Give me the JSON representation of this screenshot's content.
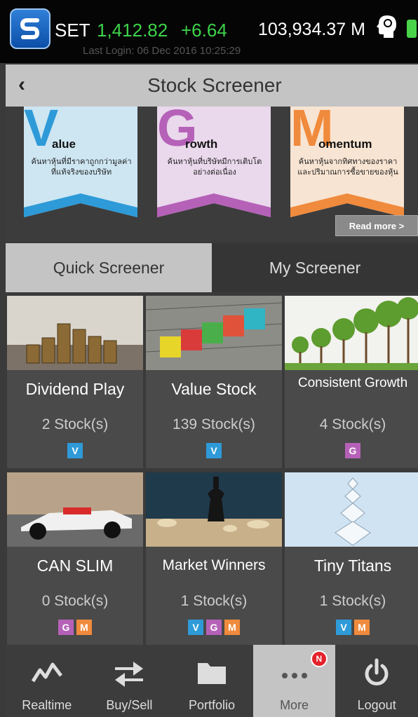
{
  "status": {
    "index_name": "SET",
    "index_value": "1,412.82",
    "index_change": "+6.64",
    "volume": "103,934.37 M",
    "last_login": "Last Login: 06 Dec 2016 10:25:29"
  },
  "header": {
    "title": "Stock Screener"
  },
  "banner": {
    "items": [
      {
        "letter": "V",
        "word": "alue",
        "desc": "ค้นหาหุ้นที่มีราคาถูกกว่ามูลค่าที่แท้จริงของบริษัท",
        "color": "#2e9ad8",
        "bg": "#cde6f2"
      },
      {
        "letter": "G",
        "word": "rowth",
        "desc": "ค้นหาหุ้นที่บริษัทมีการเติบโตอย่างต่อเนื่อง",
        "color": "#b561b8",
        "bg": "#ead8ec"
      },
      {
        "letter": "M",
        "word": "omentum",
        "desc": "ค้นหาหุ้นจากทิศทางของราคาและปริมาณการซื้อขายของหุ้น",
        "color": "#f08a3c",
        "bg": "#f8e4d2"
      }
    ],
    "read_more": "Read more >"
  },
  "tabs": [
    {
      "label": "Quick Screener",
      "active": true
    },
    {
      "label": "My Screener",
      "active": false
    }
  ],
  "screeners": [
    {
      "title": "Dividend Play",
      "count": "2 Stock(s)",
      "badges": [
        "V"
      ]
    },
    {
      "title": "Value Stock",
      "count": "139 Stock(s)",
      "badges": [
        "V"
      ]
    },
    {
      "title": "Consistent Growth",
      "count": "4 Stock(s)",
      "badges": [
        "G"
      ]
    },
    {
      "title": "CAN SLIM",
      "count": "0 Stock(s)",
      "badges": [
        "G",
        "M"
      ]
    },
    {
      "title": "Market Winners",
      "count": "1 Stock(s)",
      "badges": [
        "V",
        "G",
        "M"
      ]
    },
    {
      "title": "Tiny Titans",
      "count": "1 Stock(s)",
      "badges": [
        "V",
        "M"
      ]
    }
  ],
  "nav": [
    {
      "label": "Realtime",
      "icon": "line-chart-icon"
    },
    {
      "label": "Buy/Sell",
      "icon": "transfer-arrows-icon"
    },
    {
      "label": "Portfolio",
      "icon": "folder-icon"
    },
    {
      "label": "More",
      "icon": "more-dots-icon",
      "active": true,
      "badge": "N"
    },
    {
      "label": "Logout",
      "icon": "power-icon"
    }
  ]
}
